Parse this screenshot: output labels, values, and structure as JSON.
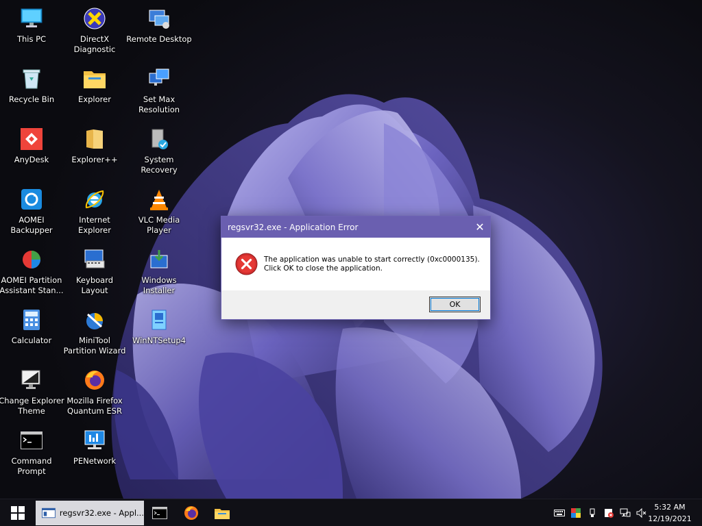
{
  "desktop": {
    "icons": [
      {
        "label": "This PC",
        "icon": "this-pc-icon"
      },
      {
        "label": "DirectX\nDiagnostic",
        "icon": "directx-icon"
      },
      {
        "label": "Remote Desktop",
        "icon": "remote-desktop-icon"
      },
      {
        "label": "Recycle Bin",
        "icon": "recycle-bin-icon"
      },
      {
        "label": "Explorer",
        "icon": "folder-icon"
      },
      {
        "label": "Set Max\nResolution",
        "icon": "monitors-icon"
      },
      {
        "label": "AnyDesk",
        "icon": "anydesk-icon"
      },
      {
        "label": "Explorer++",
        "icon": "explorerpp-icon"
      },
      {
        "label": "System Recovery",
        "icon": "system-recovery-icon"
      },
      {
        "label": "AOMEI\nBackupper",
        "icon": "aomei-backupper-icon"
      },
      {
        "label": "Internet Explorer",
        "icon": "internet-explorer-icon"
      },
      {
        "label": "VLC Media\nPlayer",
        "icon": "vlc-icon"
      },
      {
        "label": "AOMEI Partition\nAssistant Stan...",
        "icon": "aomei-partition-icon"
      },
      {
        "label": "Keyboard Layout",
        "icon": "keyboard-layout-icon"
      },
      {
        "label": "Windows\nInstaller",
        "icon": "windows-installer-icon"
      },
      {
        "label": "Calculator",
        "icon": "calculator-icon"
      },
      {
        "label": "MiniTool\nPartition Wizard",
        "icon": "minitool-icon"
      },
      {
        "label": "WinNTSetup4",
        "icon": "winntsetup-icon"
      },
      {
        "label": "Change Explorer\nTheme",
        "icon": "change-theme-icon"
      },
      {
        "label": "Mozilla Firefox\nQuantum ESR",
        "icon": "firefox-icon"
      },
      {
        "label": "Command\nPrompt",
        "icon": "cmd-icon"
      },
      {
        "label": "PENetwork",
        "icon": "penetwork-icon"
      }
    ]
  },
  "dialog": {
    "title": "regsvr32.exe - Application Error",
    "close_glyph": "✕",
    "message_line1": "The application was unable to start correctly (0xc0000135).",
    "message_line2": "Click OK to close the application.",
    "ok_label": "OK",
    "icon": "error-icon"
  },
  "taskbar": {
    "start_icon": "windows-start-icon",
    "active_window_title": "regsvr32.exe - Appl...",
    "pinned": [
      "cmd-icon",
      "firefox-icon",
      "folder-icon"
    ],
    "tray": [
      "keyboard-icon",
      "color-icon",
      "usb-icon",
      "security-icon",
      "network-icon",
      "volume-muted-icon"
    ],
    "time": "5:32 AM",
    "date": "12/19/2021"
  },
  "colors": {
    "dialog_titlebar": "#6a5fb0",
    "taskbar_bg": "#101016",
    "error_red": "#d32f2f",
    "wallpaper_accent": "#7a72c9"
  }
}
